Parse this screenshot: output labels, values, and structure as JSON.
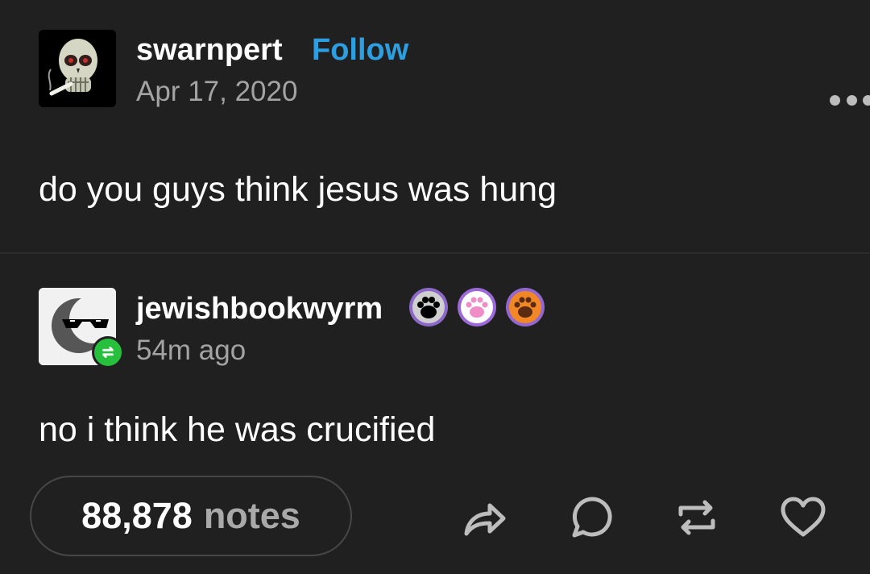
{
  "post": {
    "username": "swarnpert",
    "follow_label": "Follow",
    "date": "Apr 17, 2020",
    "body": "do you guys think jesus was hung",
    "more_icon": "more-horizontal-icon"
  },
  "reblog": {
    "username": "jewishbookwyrm",
    "time": "54m ago",
    "body": "no i think he was crucified",
    "badge_icon": "reblog-badge-icon",
    "paw_badges": [
      "purple-black-paw-icon",
      "purple-white-pink-paw-icon",
      "purple-orange-paw-icon"
    ]
  },
  "footer": {
    "notes_count": "88,878",
    "notes_label": "notes",
    "actions": [
      "share-icon",
      "comment-icon",
      "reblog-icon",
      "like-icon"
    ]
  },
  "colors": {
    "background": "#202020",
    "follow": "#2d9ee0",
    "secondary_text": "#a3a3a3",
    "reblog_green": "#27c03d"
  }
}
